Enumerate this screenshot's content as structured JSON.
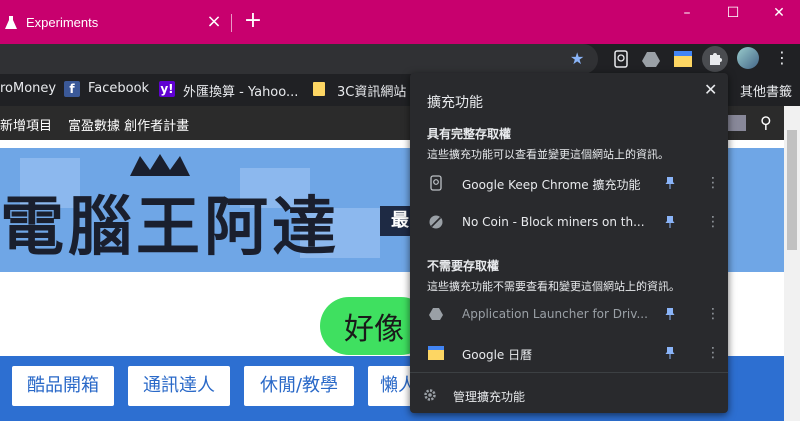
{
  "tab": {
    "title": "Experiments",
    "close_icon": "close-icon"
  },
  "toolbar": {
    "new_tab": "+"
  },
  "window": {
    "minimize": "–",
    "maximize": "☐",
    "close": "✕"
  },
  "bookmarks": [
    {
      "label": "roMoney"
    },
    {
      "label": "Facebook"
    },
    {
      "label": "外匯換算 - Yahoo..."
    },
    {
      "label": "3C資訊網站"
    },
    {
      "label": "其他書籤"
    }
  ],
  "site_bar": {
    "link1": "新增項目",
    "link2": "富盈數據 創作者計畫"
  },
  "banner": {
    "title": "電腦王阿達",
    "sub": "最"
  },
  "pill": {
    "text": "好像"
  },
  "nav_buttons": [
    "酷品開箱",
    "通訊達人",
    "休閒/教學",
    "懶人"
  ],
  "extensions_popup": {
    "title": "擴充功能",
    "section_full": {
      "heading": "具有完整存取權",
      "desc": "這些擴充功能可以查看並變更這個網站上的資訊。",
      "items": [
        {
          "label": "Google Keep Chrome 擴充功能",
          "dim": false
        },
        {
          "label": "No Coin - Block miners on th...",
          "dim": false
        }
      ]
    },
    "section_none": {
      "heading": "不需要存取權",
      "desc": "這些擴充功能不需要查看和變更這個網站上的資訊。",
      "items": [
        {
          "label": "Application Launcher for Driv...",
          "dim": true
        },
        {
          "label": "Google 日曆",
          "dim": false
        }
      ]
    },
    "manage": "管理擴充功能"
  },
  "colors": {
    "tabstrip": "#c8006e",
    "popup_bg": "#292a2d",
    "accent": "#8ab4f8"
  }
}
